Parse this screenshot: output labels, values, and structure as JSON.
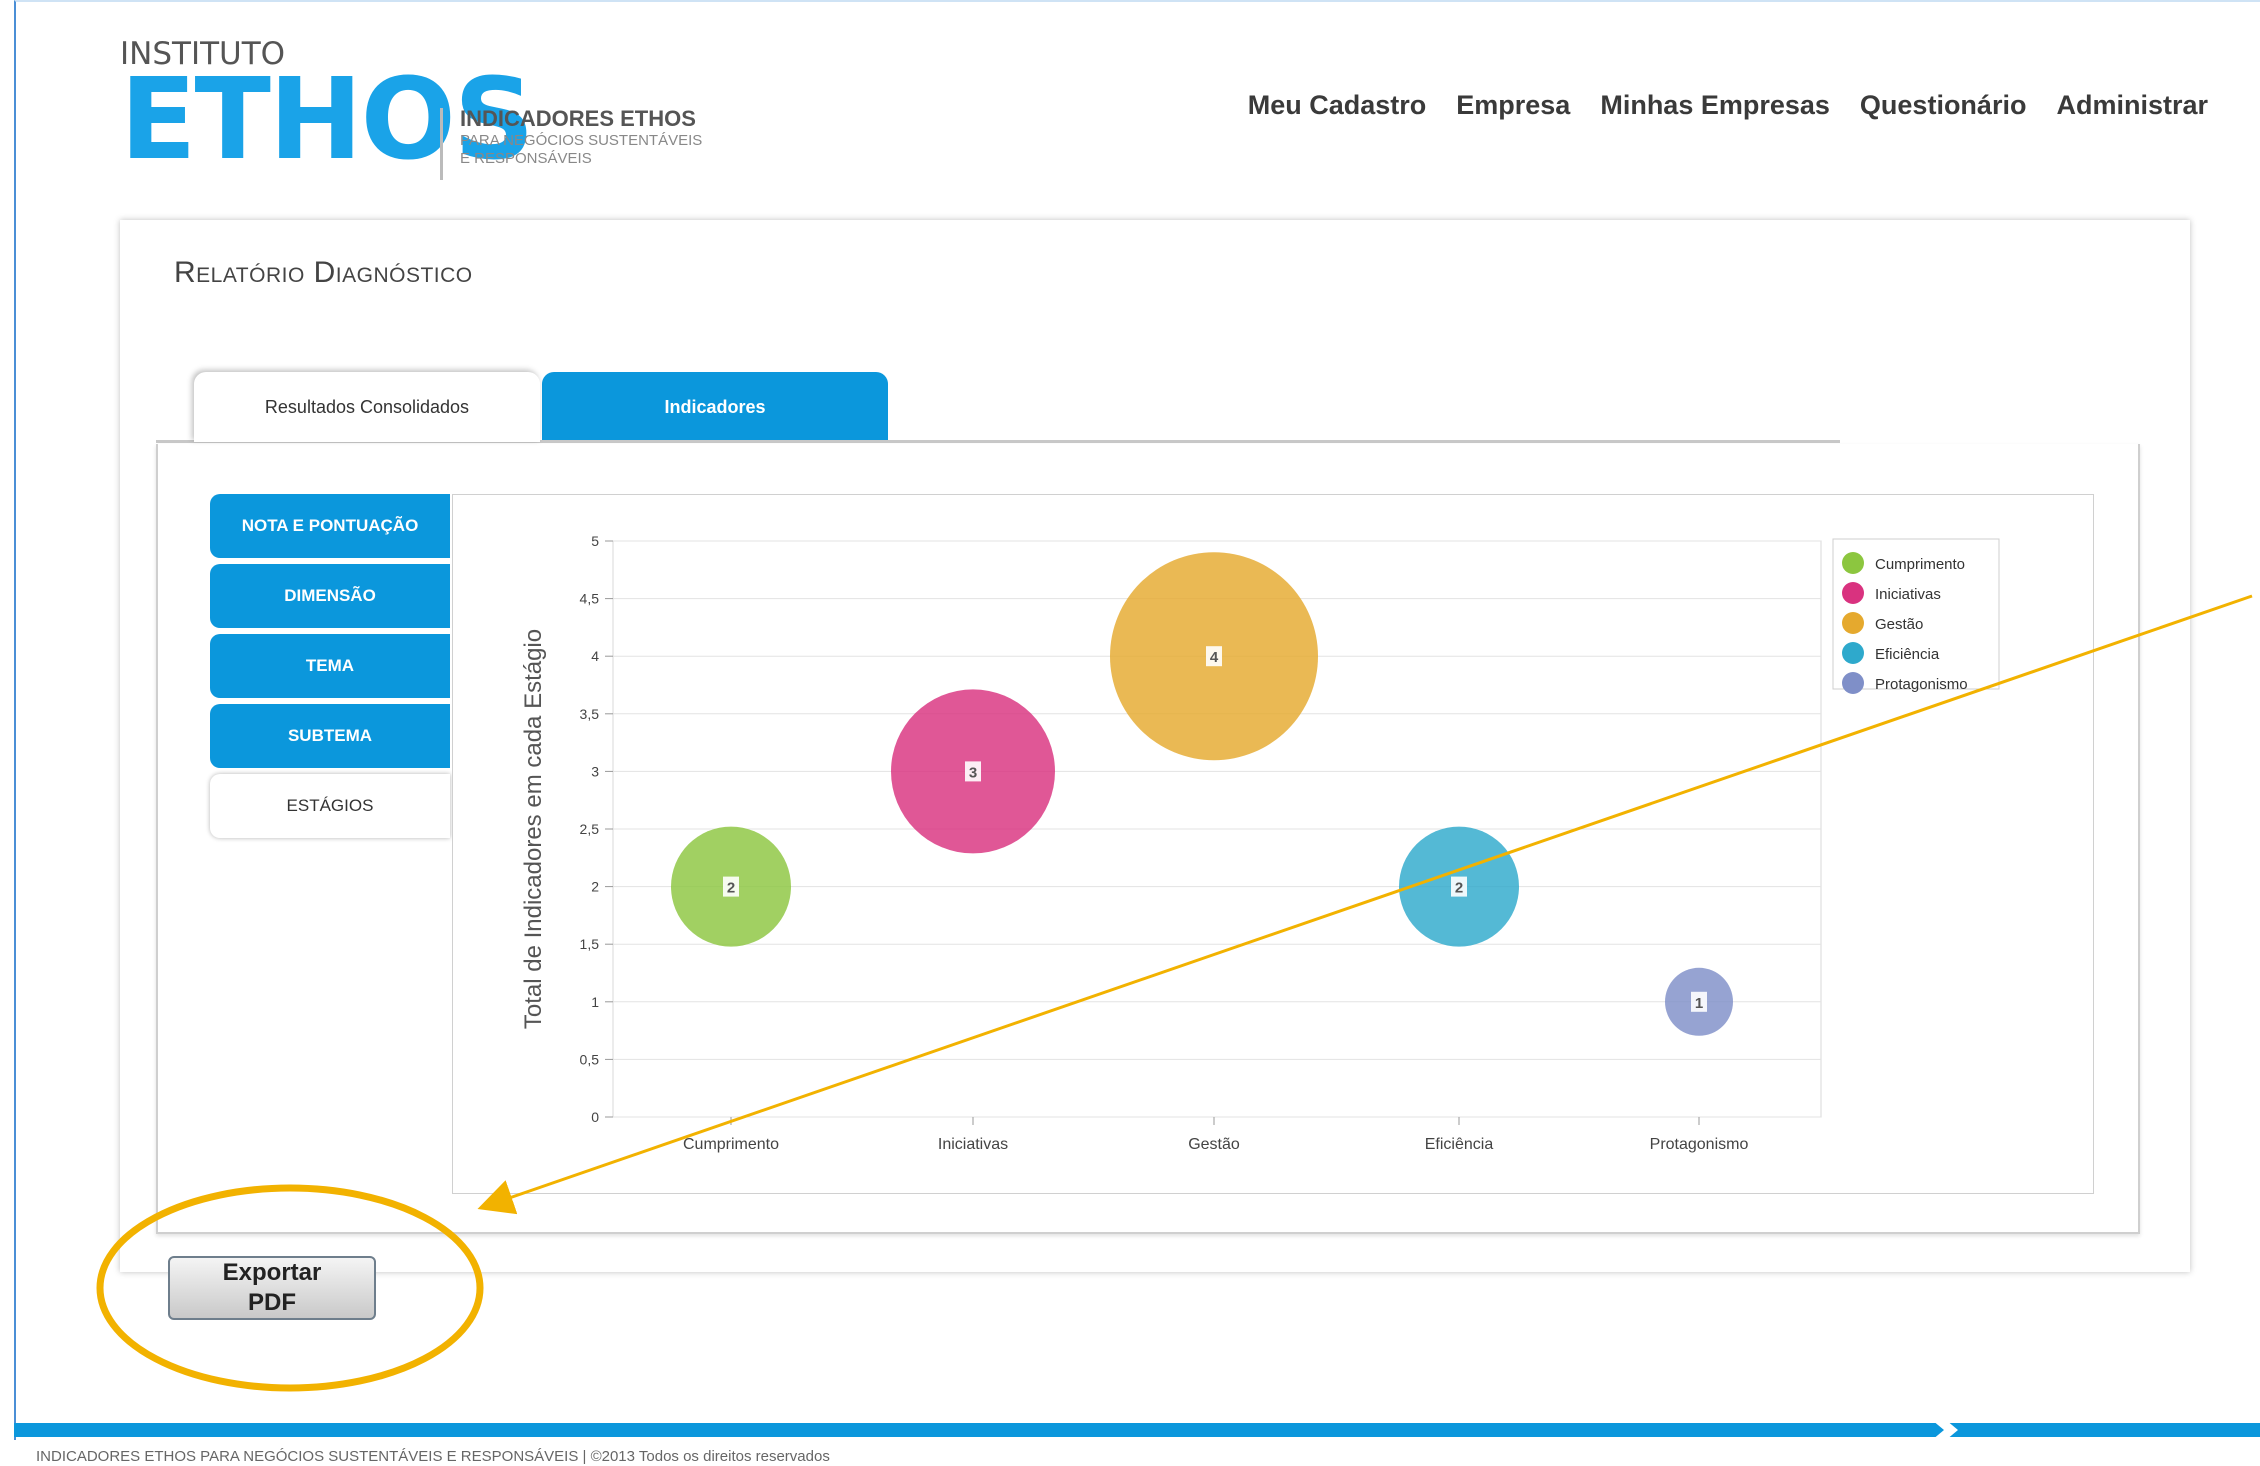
{
  "logo": {
    "small": "INSTITUTO",
    "big": "ETHOS",
    "product": "INDICADORES ETHOS",
    "sub1": "PARA NEGÓCIOS SUSTENTÁVEIS",
    "sub2": "E RESPONSÁVEIS"
  },
  "nav": {
    "items": [
      "Meu Cadastro",
      "Empresa",
      "Minhas Empresas",
      "Questionário",
      "Administrar"
    ]
  },
  "page": {
    "title": "Relatório Diagnóstico"
  },
  "tabs": [
    {
      "label": "Resultados Consolidados",
      "active": true
    },
    {
      "label": "Indicadores",
      "active": false
    }
  ],
  "side_tabs": [
    {
      "label": "NOTA E PONTUAÇÃO",
      "active": false
    },
    {
      "label": "DIMENSÃO",
      "active": false
    },
    {
      "label": "TEMA",
      "active": false
    },
    {
      "label": "SUBTEMA",
      "active": false
    },
    {
      "label": "ESTÁGIOS",
      "active": true
    }
  ],
  "export": {
    "label_line1": "Exportar",
    "label_line2": "PDF"
  },
  "footer": {
    "text": "INDICADORES ETHOS PARA NEGÓCIOS SUSTENTÁVEIS E RESPONSÁVEIS | ©2013 Todos os direitos reservados"
  },
  "colors": {
    "brand": "#1aa3e8",
    "tab_blue": "#0b97dc",
    "annotation": "#f2b200"
  },
  "chart_data": {
    "type": "bubble",
    "ylabel": "Total de Indicadores em cada Estágio",
    "ylim": [
      0,
      5
    ],
    "yticks": [
      "0",
      "0,5",
      "1",
      "1,5",
      "2",
      "2,5",
      "3",
      "3,5",
      "4",
      "4,5",
      "5"
    ],
    "categories": [
      "Cumprimento",
      "Iniciativas",
      "Gestão",
      "Eficiência",
      "Protagonismo"
    ],
    "series": [
      {
        "name": "Cumprimento",
        "value": 2,
        "label": "2",
        "color": "#8cc63f"
      },
      {
        "name": "Iniciativas",
        "value": 3,
        "label": "3",
        "color": "#d9327f"
      },
      {
        "name": "Gestão",
        "value": 4,
        "label": "4",
        "color": "#e5a92e"
      },
      {
        "name": "Eficiência",
        "value": 2,
        "label": "2",
        "color": "#2ea9cc"
      },
      {
        "name": "Protagonismo",
        "value": 1,
        "label": "1",
        "color": "#7f8fc8"
      }
    ],
    "legend_position": "top-right",
    "grid": true
  }
}
